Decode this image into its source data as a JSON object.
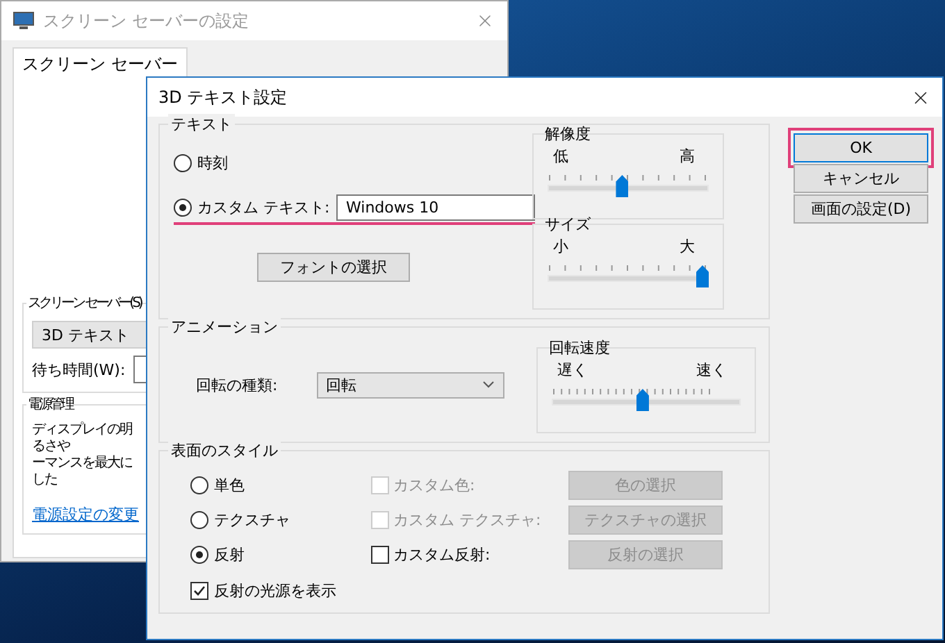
{
  "back_window": {
    "title": "スクリーン セーバーの設定",
    "tabs": [
      {
        "label": "スクリーン セーバー",
        "selected": true
      }
    ],
    "screensaver_group": {
      "label": "スクリーン セーバー(S)",
      "value": "3D テキスト",
      "wait_label": "待ち時間(W):"
    },
    "power_group": {
      "label": "電源管理",
      "lines": [
        "ディスプレイの明るさや",
        "ーマンスを最大にした"
      ],
      "link": "電源設定の変更"
    }
  },
  "dialog": {
    "title": "3D テキスト設定",
    "text_group": {
      "label": "テキスト",
      "options": [
        {
          "kind": "plain",
          "label": "時刻",
          "selected": false,
          "highlighted": false
        },
        {
          "kind": "field",
          "label": "カスタム テキスト:",
          "selected": true,
          "value": "Windows 10",
          "highlighted": true
        }
      ],
      "font_button": "フォントの選択",
      "sliders": [
        {
          "kind": "coarse",
          "label": "解像度",
          "min_label": "低",
          "max_label": "高",
          "level": 0.46
        },
        {
          "kind": "coarse",
          "label": "サイズ",
          "min_label": "小",
          "max_label": "大",
          "level": 1
        }
      ]
    },
    "animation_group": {
      "label": "アニメーション",
      "type_label": "回転の種類:",
      "type_value": "回転",
      "slider": {
        "kind": "fine",
        "label": "回転速度",
        "min_label": "遅く",
        "max_label": "速く",
        "level": 0.48
      }
    },
    "surface_group": {
      "label": "表面のスタイル",
      "rows": [
        {
          "radio": {
            "label": "単色",
            "selected": false
          },
          "checkbox": {
            "label": "カスタム色:",
            "checked": false,
            "disabled": true
          },
          "button": {
            "label": "色の選択",
            "disabled": true
          }
        },
        {
          "radio": {
            "label": "テクスチャ",
            "selected": false
          },
          "checkbox": {
            "label": "カスタム テクスチャ:",
            "checked": false,
            "disabled": true
          },
          "button": {
            "label": "テクスチャの選択",
            "disabled": true
          }
        },
        {
          "radio": {
            "label": "反射",
            "selected": true
          },
          "checkbox": {
            "label": "カスタム反射:",
            "checked": false,
            "disabled": false
          },
          "button": {
            "label": "反射の選択",
            "disabled": true
          }
        }
      ],
      "light_checkbox": {
        "label": "反射の光源を表示",
        "checked": true
      }
    },
    "buttons": [
      {
        "label": "OK",
        "default": true,
        "highlighted": true
      },
      {
        "label": "キャンセル",
        "default": false,
        "highlighted": false
      },
      {
        "label": "画面の設定(D)",
        "default": false,
        "highlighted": false
      }
    ]
  }
}
